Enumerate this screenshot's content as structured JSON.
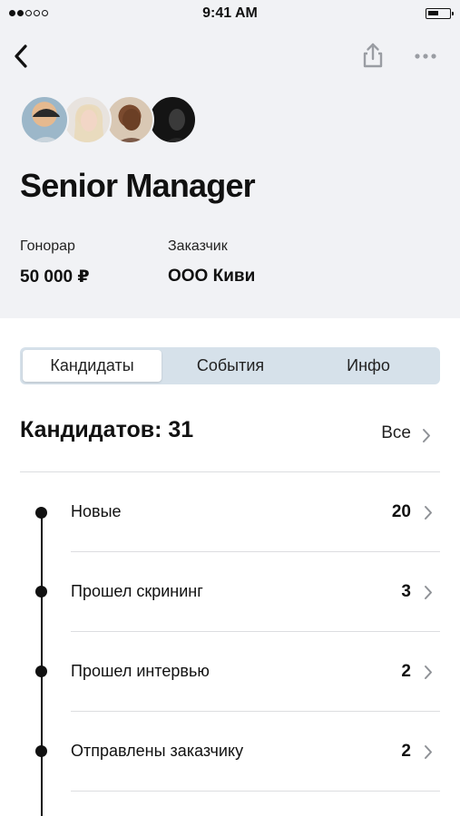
{
  "status_bar": {
    "time": "9:41 AM",
    "signal_bars_filled": 2,
    "signal_bars_total": 5
  },
  "nav": {
    "back_icon": "chevron-left-icon",
    "share_icon": "share-icon",
    "more_icon": "more-dots-icon"
  },
  "avatars": [
    "avatar-1",
    "avatar-2",
    "avatar-3",
    "avatar-4"
  ],
  "vacancy": {
    "title": "Senior Manager",
    "fee_label": "Гонорар",
    "fee_value": "50 000 ₽",
    "client_label": "Заказчик",
    "client_value": "ООО Киви"
  },
  "tabs": [
    {
      "label": "Кандидаты",
      "active": true
    },
    {
      "label": "События",
      "active": false
    },
    {
      "label": "Инфо",
      "active": false
    }
  ],
  "candidates": {
    "title": "Кандидатов: 31",
    "all_label": "Все",
    "stages": [
      {
        "label": "Новые",
        "count": "20"
      },
      {
        "label": "Прошел скрининг",
        "count": "3"
      },
      {
        "label": "Прошел интервью",
        "count": "2"
      },
      {
        "label": "Отправлены заказчику",
        "count": "2"
      }
    ]
  },
  "colors": {
    "header_bg": "#f1f2f5",
    "segmented_bg": "#d6e1ea",
    "divider": "#dcdde0"
  }
}
